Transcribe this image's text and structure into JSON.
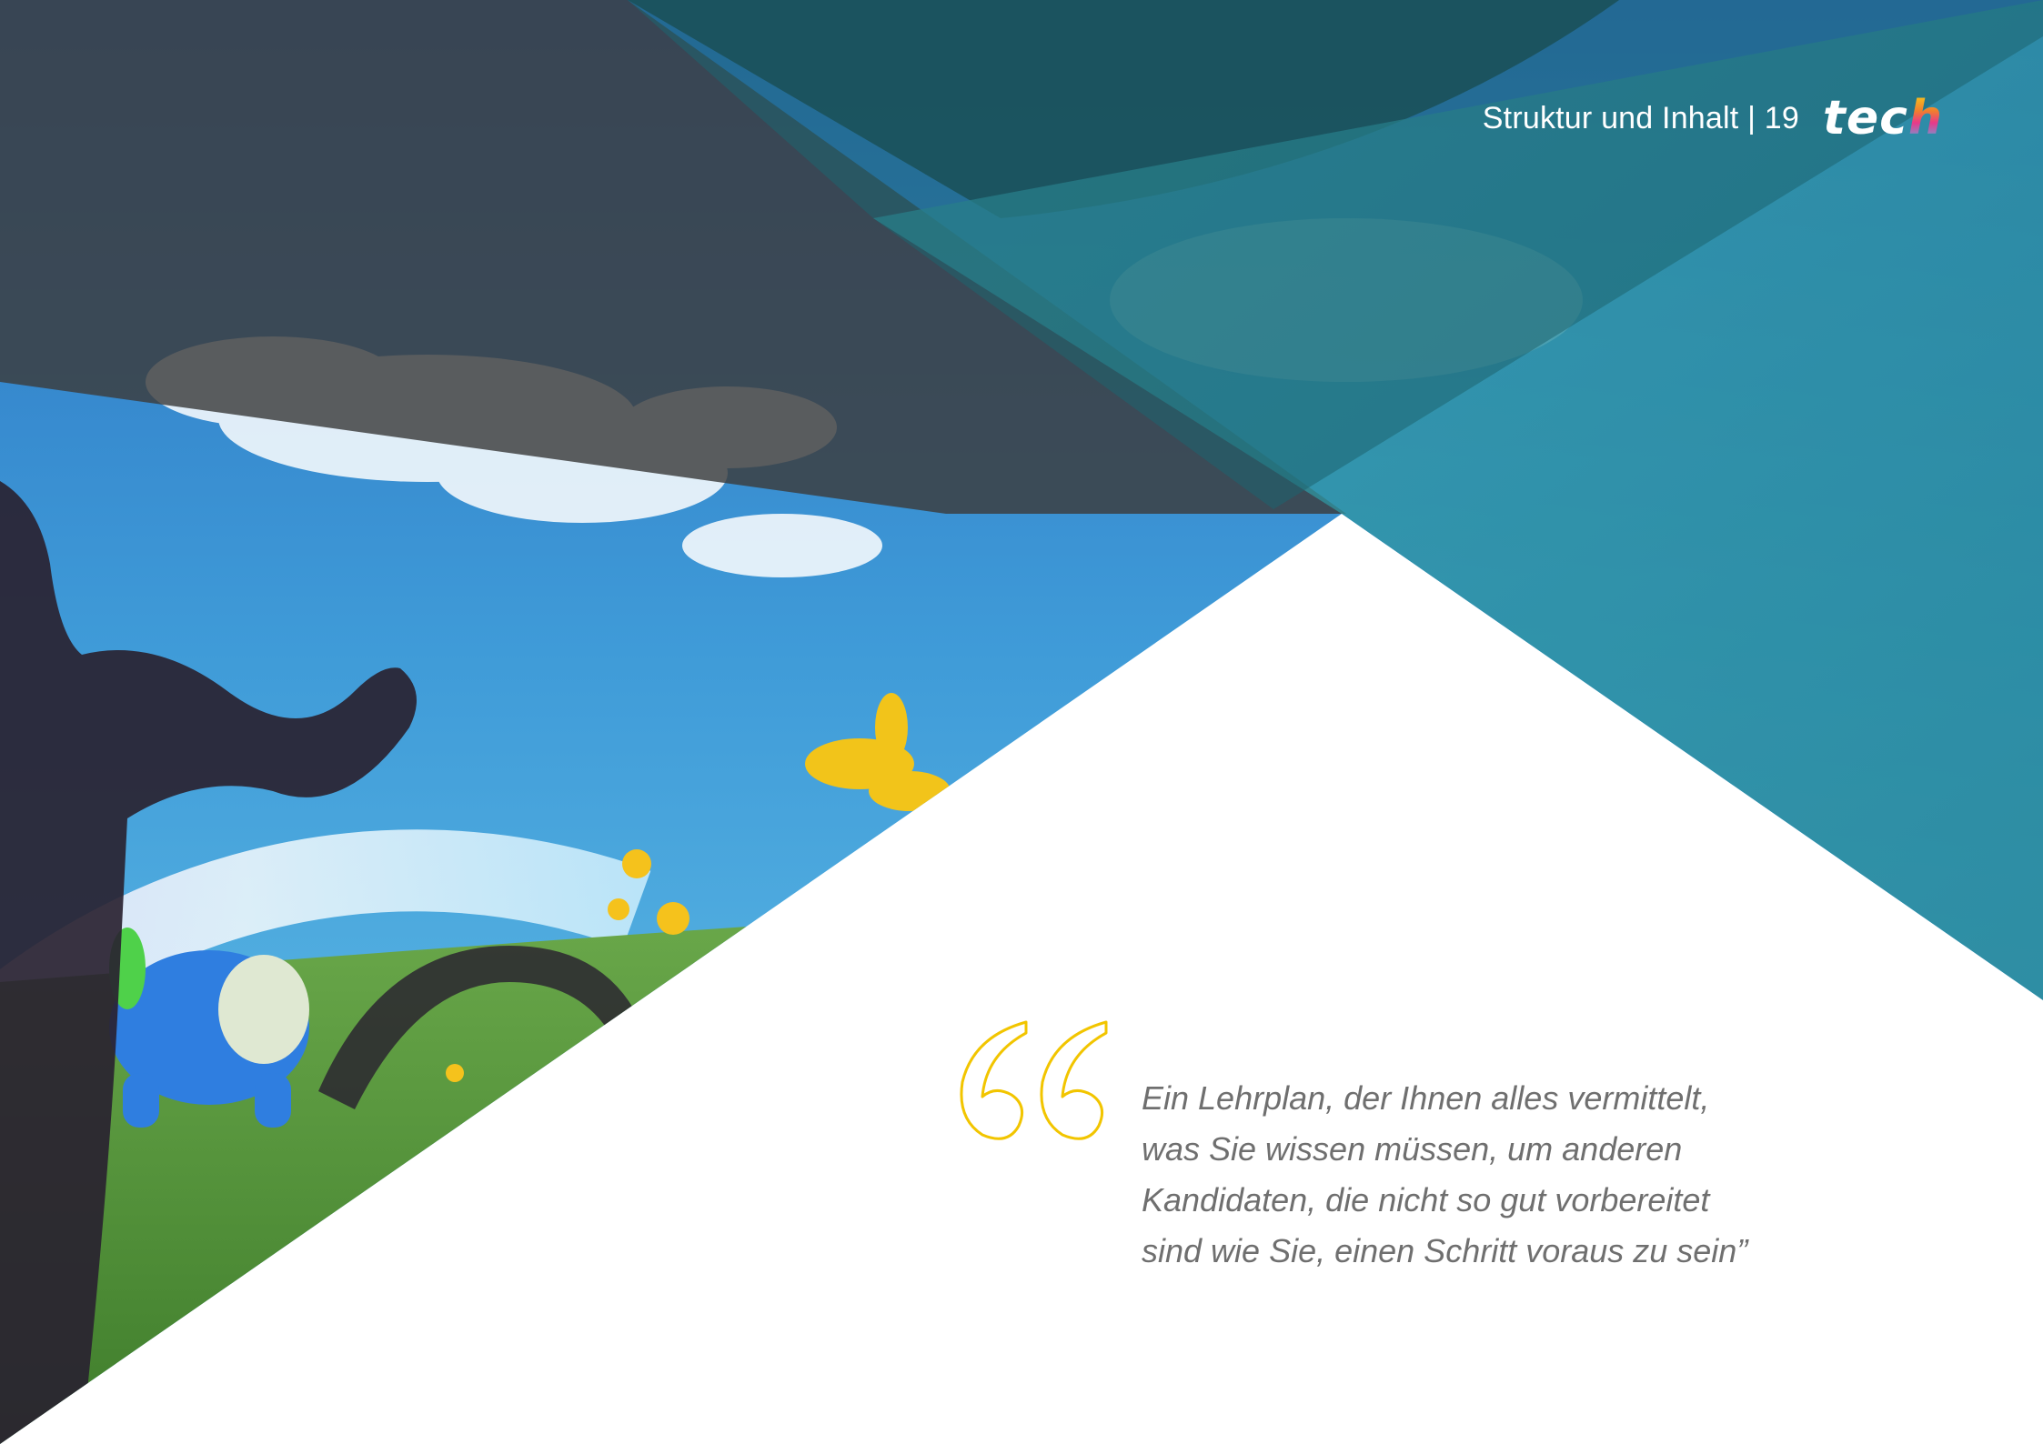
{
  "header": {
    "section_title": "Struktur und Inhalt",
    "separator": "|",
    "page_number": "19",
    "logo_main": "tec",
    "logo_accent": "h"
  },
  "quote": {
    "lines": [
      "Ein Lehrplan, der Ihnen alles vermittelt,",
      "was Sie wissen müssen, um anderen",
      "Kandidaten, die nicht so gut vorbereitet",
      "sind wie Sie, einen Schritt voraus zu sein”"
    ]
  },
  "colors": {
    "teal": "#2e8e99",
    "teal_dark": "#1d5f6a",
    "overlay_gray": "#464646",
    "quote_mark": "#f2c500",
    "quote_text": "#6f6f6f",
    "background": "#ffffff"
  },
  "icons": {
    "quote_mark": "open-double-quote-icon",
    "logo": "tech-logo"
  }
}
